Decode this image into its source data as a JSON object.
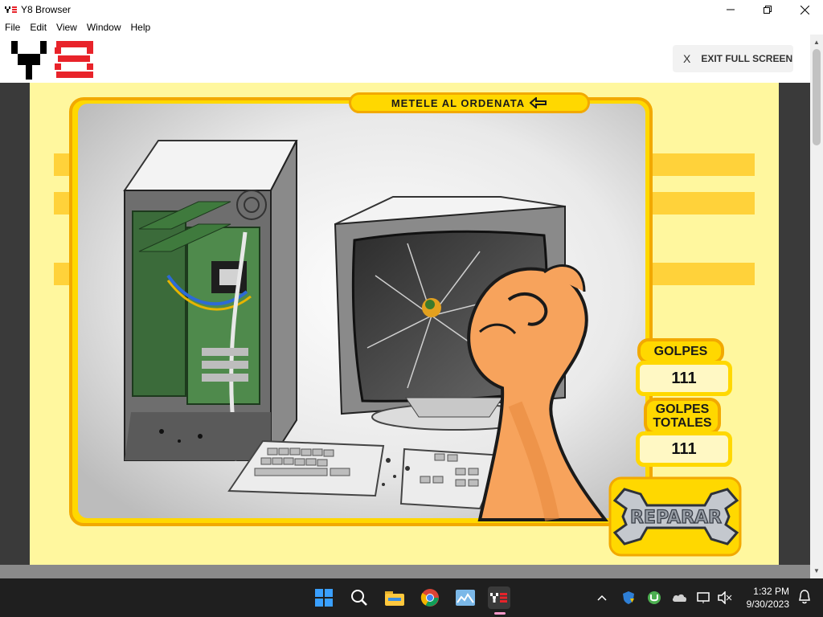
{
  "window": {
    "title": "Y8 Browser",
    "controls": [
      "minimize",
      "restore",
      "close"
    ]
  },
  "menu": {
    "items": [
      "File",
      "Edit",
      "View",
      "Window",
      "Help"
    ]
  },
  "header": {
    "exit_fullscreen_x": "X",
    "exit_fullscreen_label": "EXIT FULL SCREEN"
  },
  "game": {
    "title": "METELE AL ORDENATA",
    "golpes_label": "GOLPES",
    "golpes_value": "111",
    "golpes_totales_label_1": "GOLPES",
    "golpes_totales_label_2": "TOTALES",
    "golpes_totales_value": "111",
    "repair_label": "REPARAR"
  },
  "taskbar": {
    "apps": [
      "start-icon",
      "search-icon",
      "file-explorer-icon",
      "chrome-icon",
      "photos-icon",
      "y8-browser-icon"
    ],
    "time": "1:32 PM",
    "date": "9/30/2023"
  },
  "colors": {
    "game_bg": "#fff79e",
    "accent_yellow": "#ffd800",
    "accent_orange": "#f2a900",
    "y8_red": "#e8232a",
    "taskbar_bg": "#1f1f1f"
  }
}
